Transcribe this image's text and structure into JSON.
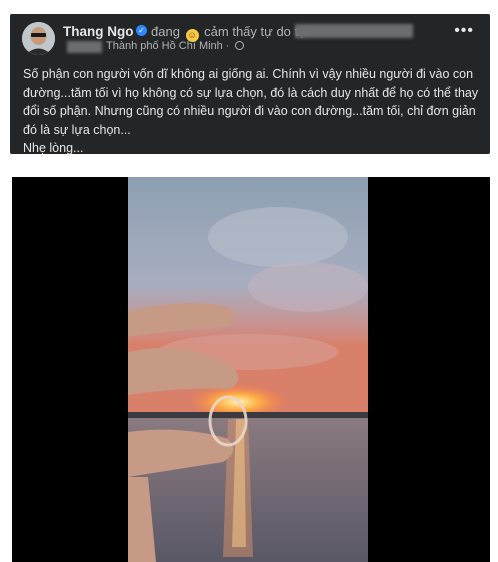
{
  "post": {
    "author": "Thang Ngo",
    "feeling_prefix": "đang",
    "feeling_text": "cảm thấy tự do tại",
    "location": "Thành phố Hồ Chí Minh ·",
    "more_label": "•••",
    "text_lines": [
      "Số phận con người vốn dĩ không ai giống ai. Chính vì vậy nhiều người đi vào con đường...tăm tối vì họ không có sự lựa chọn, đó là cách duy nhất để họ có thể thay đổi số phận. Nhưng cũng có nhiều người đi vào con đường...tăm tối, chỉ đơn giản đó là sự lựa chọn...",
      "Nhẹ lòng..."
    ]
  },
  "icons": {
    "verified": "verified-badge-icon",
    "emoji": "smiley-emoji-icon",
    "privacy": "globe-icon",
    "more": "more-options-icon"
  },
  "colors": {
    "card_bg": "#242526",
    "text_primary": "#e4e6eb",
    "text_secondary": "#b0b3b8",
    "verified_blue": "#2d88ff"
  }
}
